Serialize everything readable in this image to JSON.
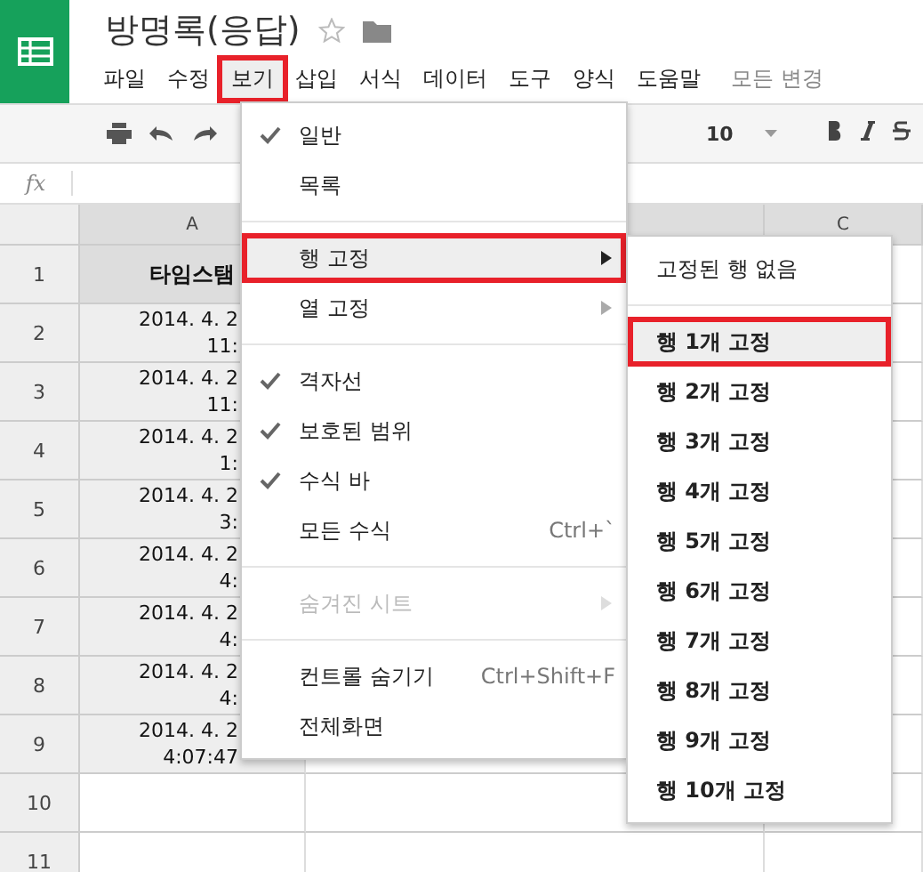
{
  "document": {
    "title": "방명록(응답)",
    "starred": false
  },
  "menu_bar": [
    {
      "label": "파일",
      "selected": false,
      "annotated": false
    },
    {
      "label": "수정",
      "selected": false,
      "annotated": false
    },
    {
      "label": "보기",
      "selected": true,
      "annotated": true
    },
    {
      "label": "삽입",
      "selected": false,
      "annotated": false
    },
    {
      "label": "서식",
      "selected": false,
      "annotated": false
    },
    {
      "label": "데이터",
      "selected": false,
      "annotated": false
    },
    {
      "label": "도구",
      "selected": false,
      "annotated": false
    },
    {
      "label": "양식",
      "selected": false,
      "annotated": false
    },
    {
      "label": "도움말",
      "selected": false,
      "annotated": false
    }
  ],
  "save_status": "모든 변경",
  "toolbar": {
    "font_size": "10"
  },
  "formula_bar": {
    "label": "fx"
  },
  "sheet": {
    "columns": [
      "A",
      "",
      "C"
    ],
    "rows": [
      {
        "number": "1",
        "cells": [
          {
            "kind": "header",
            "lines": [
              "타임스탬"
            ]
          }
        ]
      },
      {
        "number": "2",
        "cells": [
          {
            "kind": "date",
            "lines": [
              "2014. 4. 2",
              "11:"
            ]
          }
        ]
      },
      {
        "number": "3",
        "cells": [
          {
            "kind": "date",
            "lines": [
              "2014. 4. 2",
              "11:"
            ]
          }
        ]
      },
      {
        "number": "4",
        "cells": [
          {
            "kind": "date",
            "lines": [
              "2014. 4. 2",
              "1:"
            ]
          }
        ]
      },
      {
        "number": "5",
        "cells": [
          {
            "kind": "date",
            "lines": [
              "2014. 4. 2",
              "3:"
            ]
          }
        ]
      },
      {
        "number": "6",
        "cells": [
          {
            "kind": "date",
            "lines": [
              "2014. 4. 2",
              "4:"
            ]
          }
        ]
      },
      {
        "number": "7",
        "cells": [
          {
            "kind": "date",
            "lines": [
              "2014. 4. 2",
              "4:"
            ]
          }
        ]
      },
      {
        "number": "8",
        "cells": [
          {
            "kind": "date",
            "lines": [
              "2014. 4. 2",
              "4:"
            ]
          }
        ]
      },
      {
        "number": "9",
        "cells": [
          {
            "kind": "date",
            "lines": [
              "2014. 4. 2",
              "4:07:47"
            ]
          }
        ]
      },
      {
        "number": "10",
        "cells": []
      },
      {
        "number": "11",
        "cells": []
      }
    ]
  },
  "view_menu": [
    {
      "kind": "item",
      "label": "일반",
      "checked": true,
      "selected": false,
      "annotated": false,
      "disabled": false,
      "submenu": false
    },
    {
      "kind": "item",
      "label": "목록",
      "checked": false,
      "selected": false,
      "annotated": false,
      "disabled": false,
      "submenu": false
    },
    {
      "kind": "separator"
    },
    {
      "kind": "item",
      "label": "행 고정",
      "checked": false,
      "selected": true,
      "annotated": true,
      "disabled": false,
      "submenu": true
    },
    {
      "kind": "item",
      "label": "열 고정",
      "checked": false,
      "selected": false,
      "annotated": false,
      "disabled": false,
      "submenu": true
    },
    {
      "kind": "separator"
    },
    {
      "kind": "item",
      "label": "격자선",
      "checked": true,
      "selected": false,
      "annotated": false,
      "disabled": false,
      "submenu": false
    },
    {
      "kind": "item",
      "label": "보호된 범위",
      "checked": true,
      "selected": false,
      "annotated": false,
      "disabled": false,
      "submenu": false
    },
    {
      "kind": "item",
      "label": "수식 바",
      "checked": true,
      "selected": false,
      "annotated": false,
      "disabled": false,
      "submenu": false
    },
    {
      "kind": "item",
      "label": "모든 수식",
      "shortcut": "Ctrl+`",
      "checked": false,
      "selected": false,
      "annotated": false,
      "disabled": false,
      "submenu": false
    },
    {
      "kind": "separator"
    },
    {
      "kind": "item",
      "label": "숨겨진 시트",
      "checked": false,
      "selected": false,
      "annotated": false,
      "disabled": true,
      "submenu": true
    },
    {
      "kind": "separator"
    },
    {
      "kind": "item",
      "label": "컨트롤 숨기기",
      "shortcut": "Ctrl+Shift+F",
      "checked": false,
      "selected": false,
      "annotated": false,
      "disabled": false,
      "submenu": false
    },
    {
      "kind": "item",
      "label": "전체화면",
      "checked": false,
      "selected": false,
      "annotated": false,
      "disabled": false,
      "submenu": false
    }
  ],
  "freeze_rows_submenu": [
    {
      "kind": "item",
      "label": "고정된 행 없음",
      "bold": false,
      "selected": false,
      "annotated": false
    },
    {
      "kind": "separator"
    },
    {
      "kind": "item",
      "label": "행 1개 고정",
      "bold": true,
      "selected": true,
      "annotated": true
    },
    {
      "kind": "item",
      "label": "행 2개 고정",
      "bold": true,
      "selected": false,
      "annotated": false
    },
    {
      "kind": "item",
      "label": "행 3개 고정",
      "bold": true,
      "selected": false,
      "annotated": false
    },
    {
      "kind": "item",
      "label": "행 4개 고정",
      "bold": true,
      "selected": false,
      "annotated": false
    },
    {
      "kind": "item",
      "label": "행 5개 고정",
      "bold": true,
      "selected": false,
      "annotated": false
    },
    {
      "kind": "item",
      "label": "행 6개 고정",
      "bold": true,
      "selected": false,
      "annotated": false
    },
    {
      "kind": "item",
      "label": "행 7개 고정",
      "bold": true,
      "selected": false,
      "annotated": false
    },
    {
      "kind": "item",
      "label": "행 8개 고정",
      "bold": true,
      "selected": false,
      "annotated": false
    },
    {
      "kind": "item",
      "label": "행 9개 고정",
      "bold": true,
      "selected": false,
      "annotated": false
    },
    {
      "kind": "item",
      "label": "행 10개 고정",
      "bold": true,
      "selected": false,
      "annotated": false
    }
  ]
}
